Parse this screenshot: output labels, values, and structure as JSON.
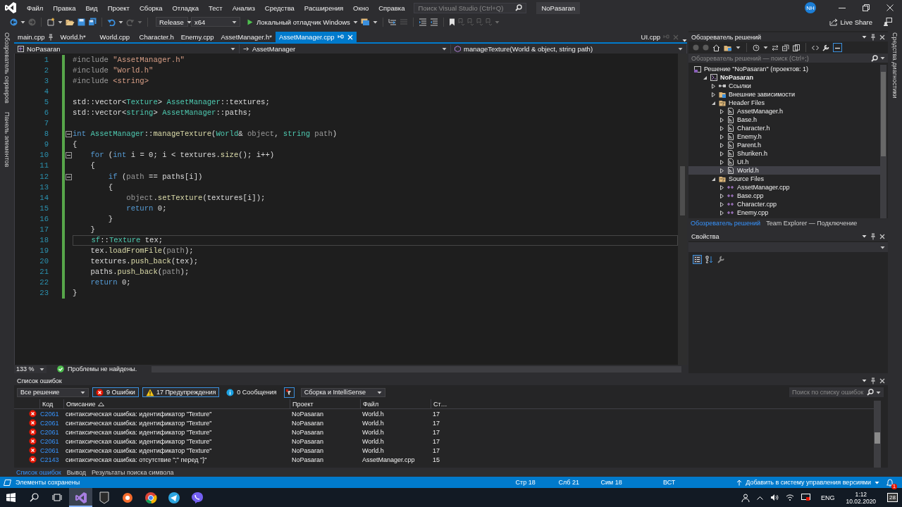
{
  "window": {
    "title": "NoPasaran",
    "account_initials": "NH"
  },
  "menu": [
    "Файл",
    "Правка",
    "Вид",
    "Проект",
    "Сборка",
    "Отладка",
    "Тест",
    "Анализ",
    "Средства",
    "Расширения",
    "Окно",
    "Справка"
  ],
  "search": {
    "placeholder": "Поиск Visual Studio (Ctrl+Q)"
  },
  "toolbar": {
    "configuration": "Release",
    "platform": "x64",
    "debugger": "Локальный отладчик Windows",
    "live_share": "Live Share"
  },
  "side_strips": {
    "left": [
      "Обозреватель серверов",
      "Панель элементов"
    ],
    "right": [
      "Средства диагностики"
    ]
  },
  "editor": {
    "tabs": [
      {
        "label": "main.cpp",
        "selected": false,
        "pinned": true
      },
      {
        "label": "World.h*",
        "selected": false,
        "pinned": false
      },
      {
        "label": "World.cpp",
        "selected": false,
        "pinned": false
      },
      {
        "label": "Character.h",
        "selected": false,
        "pinned": false
      },
      {
        "label": "Enemy.cpp",
        "selected": false,
        "pinned": false
      },
      {
        "label": "AssetManager.h*",
        "selected": false,
        "pinned": false
      },
      {
        "label": "AssetManager.cpp",
        "selected": true,
        "pinned": false
      }
    ],
    "right_tab": {
      "label": "UI.cpp"
    },
    "navigation": {
      "project": "NoPasaran",
      "class": "AssetManager",
      "member": "manageTexture(World & object, string path)"
    },
    "lines": [
      {
        "number": "1",
        "changed": true,
        "foldable": false,
        "current": false,
        "tokens": [
          {
            "kind": "preproc",
            "text": "#include "
          },
          {
            "kind": "string",
            "text": "\"AssetManager.h\""
          }
        ]
      },
      {
        "number": "2",
        "changed": true,
        "foldable": false,
        "current": false,
        "tokens": [
          {
            "kind": "preproc",
            "text": "#include "
          },
          {
            "kind": "string",
            "text": "\"World.h\""
          }
        ]
      },
      {
        "number": "3",
        "changed": true,
        "foldable": false,
        "current": false,
        "tokens": [
          {
            "kind": "preproc",
            "text": "#include "
          },
          {
            "kind": "string",
            "text": "<string>"
          }
        ]
      },
      {
        "number": "4",
        "changed": true,
        "foldable": false,
        "current": false
      },
      {
        "number": "5",
        "changed": true,
        "foldable": false,
        "current": false,
        "tokens": [
          {
            "kind": "plain",
            "text": "std::vector<"
          },
          {
            "kind": "type",
            "text": "Texture"
          },
          {
            "kind": "plain",
            "text": "> "
          },
          {
            "kind": "type",
            "text": "AssetManager"
          },
          {
            "kind": "plain",
            "text": "::textures;"
          }
        ]
      },
      {
        "number": "6",
        "changed": true,
        "foldable": false,
        "current": false,
        "tokens": [
          {
            "kind": "plain",
            "text": "std::vector<"
          },
          {
            "kind": "type",
            "text": "string"
          },
          {
            "kind": "plain",
            "text": "> "
          },
          {
            "kind": "type",
            "text": "AssetManager"
          },
          {
            "kind": "plain",
            "text": "::paths;"
          }
        ]
      },
      {
        "number": "7",
        "changed": true,
        "foldable": false,
        "current": false
      },
      {
        "number": "8",
        "changed": true,
        "foldable": true,
        "current": false,
        "tokens": [
          {
            "kind": "keyword",
            "text": "int"
          },
          {
            "kind": "type",
            "text": " AssetManager"
          },
          {
            "kind": "plain",
            "text": "::"
          },
          {
            "kind": "function",
            "text": "manageTexture"
          },
          {
            "kind": "plain",
            "text": "("
          },
          {
            "kind": "type",
            "text": "World"
          },
          {
            "kind": "plain",
            "text": "& "
          },
          {
            "kind": "param",
            "text": "object"
          },
          {
            "kind": "plain",
            "text": ", "
          },
          {
            "kind": "type",
            "text": "string"
          },
          {
            "kind": "param",
            "text": " path"
          },
          {
            "kind": "plain",
            "text": ")"
          }
        ]
      },
      {
        "number": "9",
        "changed": true,
        "foldable": false,
        "current": false,
        "tokens": [
          {
            "kind": "plain",
            "text": "{"
          }
        ]
      },
      {
        "number": "10",
        "changed": true,
        "foldable": true,
        "current": false,
        "tokens": [
          {
            "kind": "keyword",
            "text": "    for"
          },
          {
            "kind": "plain",
            "text": " ("
          },
          {
            "kind": "keyword",
            "text": "int"
          },
          {
            "kind": "plain",
            "text": " i = 0; i < textures."
          },
          {
            "kind": "function",
            "text": "size"
          },
          {
            "kind": "plain",
            "text": "(); i++)"
          }
        ]
      },
      {
        "number": "11",
        "changed": true,
        "foldable": false,
        "current": false,
        "tokens": [
          {
            "kind": "plain",
            "text": "    {"
          }
        ]
      },
      {
        "number": "12",
        "changed": true,
        "foldable": true,
        "current": false,
        "tokens": [
          {
            "kind": "keyword",
            "text": "        if"
          },
          {
            "kind": "plain",
            "text": " ("
          },
          {
            "kind": "param",
            "text": "path"
          },
          {
            "kind": "plain",
            "text": " == paths[i])"
          }
        ]
      },
      {
        "number": "13",
        "changed": true,
        "foldable": false,
        "current": false,
        "tokens": [
          {
            "kind": "plain",
            "text": "        {"
          }
        ]
      },
      {
        "number": "14",
        "changed": true,
        "foldable": false,
        "current": false,
        "tokens": [
          {
            "kind": "param",
            "text": "            object"
          },
          {
            "kind": "plain",
            "text": "."
          },
          {
            "kind": "function",
            "text": "setTexture"
          },
          {
            "kind": "plain",
            "text": "(textures[i]);"
          }
        ]
      },
      {
        "number": "15",
        "changed": true,
        "foldable": false,
        "current": false,
        "tokens": [
          {
            "kind": "keyword",
            "text": "            return"
          },
          {
            "kind": "plain",
            "text": " 0;"
          }
        ]
      },
      {
        "number": "16",
        "changed": true,
        "foldable": false,
        "current": false,
        "tokens": [
          {
            "kind": "plain",
            "text": "        }"
          }
        ]
      },
      {
        "number": "17",
        "changed": true,
        "foldable": false,
        "current": false,
        "tokens": [
          {
            "kind": "plain",
            "text": "    }"
          }
        ]
      },
      {
        "number": "18",
        "changed": true,
        "foldable": false,
        "current": true,
        "tokens": [
          {
            "kind": "type",
            "text": "    sf"
          },
          {
            "kind": "plain",
            "text": "::"
          },
          {
            "kind": "type",
            "text": "Texture"
          },
          {
            "kind": "plain",
            "text": " tex;"
          }
        ]
      },
      {
        "number": "19",
        "changed": true,
        "foldable": false,
        "current": false,
        "tokens": [
          {
            "kind": "plain",
            "text": "    tex."
          },
          {
            "kind": "function",
            "text": "loadFromFile"
          },
          {
            "kind": "plain",
            "text": "("
          },
          {
            "kind": "param",
            "text": "path"
          },
          {
            "kind": "plain",
            "text": ");"
          }
        ]
      },
      {
        "number": "20",
        "changed": true,
        "foldable": false,
        "current": false,
        "tokens": [
          {
            "kind": "plain",
            "text": "    textures."
          },
          {
            "kind": "function",
            "text": "push_back"
          },
          {
            "kind": "plain",
            "text": "(tex);"
          }
        ]
      },
      {
        "number": "21",
        "changed": true,
        "foldable": false,
        "current": false,
        "tokens": [
          {
            "kind": "plain",
            "text": "    paths."
          },
          {
            "kind": "function",
            "text": "push_back"
          },
          {
            "kind": "plain",
            "text": "("
          },
          {
            "kind": "param",
            "text": "path"
          },
          {
            "kind": "plain",
            "text": ");"
          }
        ]
      },
      {
        "number": "22",
        "changed": true,
        "foldable": false,
        "current": false,
        "tokens": [
          {
            "kind": "keyword",
            "text": "    return"
          },
          {
            "kind": "plain",
            "text": " 0;"
          }
        ]
      },
      {
        "number": "23",
        "changed": true,
        "foldable": false,
        "current": false,
        "tokens": [
          {
            "kind": "plain",
            "text": "}"
          }
        ]
      }
    ],
    "zoom": "133 %",
    "issues": "Проблемы не найдены."
  },
  "solution_explorer": {
    "title": "Обозреватель решений",
    "search_placeholder": "Обозреватель решений — поиск (Ctrl+;)",
    "tree": [
      {
        "kind": "solution",
        "label": "Решение \"NoPasaran\"  (проектов: 1)",
        "selected": false,
        "children": [
          {
            "kind": "project",
            "label": "NoPasaran",
            "selected": false,
            "expanded": true,
            "children": [
              {
                "kind": "references",
                "label": "Ссылки",
                "selected": false,
                "expanded": false
              },
              {
                "kind": "external",
                "label": "Внешние зависимости",
                "selected": false,
                "expanded": false
              },
              {
                "kind": "folder",
                "label": "Header Files",
                "selected": false,
                "expanded": true,
                "children": [
                  {
                    "kind": "header",
                    "label": "AssetManager.h",
                    "selected": false,
                    "expanded": false
                  },
                  {
                    "kind": "header",
                    "label": "Base.h",
                    "selected": false,
                    "expanded": false
                  },
                  {
                    "kind": "header",
                    "label": "Character.h",
                    "selected": false,
                    "expanded": false
                  },
                  {
                    "kind": "header",
                    "label": "Enemy.h",
                    "selected": false,
                    "expanded": false
                  },
                  {
                    "kind": "header",
                    "label": "Parent.h",
                    "selected": false,
                    "expanded": false
                  },
                  {
                    "kind": "header",
                    "label": "Shuriken.h",
                    "selected": false,
                    "expanded": false
                  },
                  {
                    "kind": "header",
                    "label": "UI.h",
                    "selected": false,
                    "expanded": false
                  },
                  {
                    "kind": "header",
                    "label": "World.h",
                    "selected": true,
                    "expanded": false
                  }
                ]
              },
              {
                "kind": "folder",
                "label": "Source Files",
                "selected": false,
                "expanded": true,
                "children": [
                  {
                    "kind": "source",
                    "label": "AssetManager.cpp",
                    "selected": false,
                    "expanded": false
                  },
                  {
                    "kind": "source",
                    "label": "Base.cpp",
                    "selected": false,
                    "expanded": false
                  },
                  {
                    "kind": "source",
                    "label": "Character.cpp",
                    "selected": false,
                    "expanded": false
                  },
                  {
                    "kind": "source",
                    "label": "Enemy.cpp",
                    "selected": false,
                    "expanded": false
                  }
                ]
              }
            ]
          }
        ]
      }
    ],
    "tabs": [
      {
        "label": "Обозреватель решений",
        "selected": true
      },
      {
        "label": "Team Explorer — Подключение",
        "selected": false
      }
    ]
  },
  "properties": {
    "title": "Свойства"
  },
  "error_list": {
    "title": "Список ошибок",
    "scope": "Все решение",
    "filters": [
      {
        "kind": "error",
        "label": "9 Ошибки",
        "selected": true
      },
      {
        "kind": "warning",
        "label": "17 Предупреждения",
        "selected": true
      },
      {
        "kind": "message",
        "label": "0 Сообщения",
        "selected": false
      }
    ],
    "source": "Сборка и IntelliSense",
    "search_placeholder": "Поиск по списку ошибок",
    "columns": [
      "Код",
      "Описание",
      "Проект",
      "Файл",
      "Ст…"
    ],
    "rows": [
      {
        "code": "C2061",
        "description": "синтаксическая ошибка: идентификатор \"Texture\"",
        "project": "NoPasaran",
        "file": "World.h",
        "line": "17"
      },
      {
        "code": "C2061",
        "description": "синтаксическая ошибка: идентификатор \"Texture\"",
        "project": "NoPasaran",
        "file": "World.h",
        "line": "17"
      },
      {
        "code": "C2061",
        "description": "синтаксическая ошибка: идентификатор \"Texture\"",
        "project": "NoPasaran",
        "file": "World.h",
        "line": "17"
      },
      {
        "code": "C2061",
        "description": "синтаксическая ошибка: идентификатор \"Texture\"",
        "project": "NoPasaran",
        "file": "World.h",
        "line": "17"
      },
      {
        "code": "C2061",
        "description": "синтаксическая ошибка: идентификатор \"Texture\"",
        "project": "NoPasaran",
        "file": "World.h",
        "line": "17"
      },
      {
        "code": "C2143",
        "description": "синтаксическая ошибка: отсутствие \";\" перед \"}\"",
        "project": "NoPasaran",
        "file": "AssetManager.cpp",
        "line": "15"
      }
    ],
    "tabs": [
      {
        "label": "Список ошибок",
        "selected": true
      },
      {
        "label": "Вывод",
        "selected": false
      },
      {
        "label": "Результаты поиска символа",
        "selected": false
      }
    ]
  },
  "status_bar": {
    "message": "Элементы сохранены",
    "line": "Стр 18",
    "column": "Слб 21",
    "char": "Сим 18",
    "mode": "ВСТ",
    "source_control": "Добавить в систему управления версиями",
    "notifications": "1"
  },
  "taskbar": {
    "apps": [
      {
        "kind": "visual-studio",
        "selected": true
      },
      {
        "kind": "epic",
        "selected": false
      },
      {
        "kind": "origin",
        "selected": false
      },
      {
        "kind": "chrome",
        "selected": false
      },
      {
        "kind": "telegram",
        "selected": false
      },
      {
        "kind": "viber",
        "selected": false
      }
    ],
    "language": "ENG",
    "time": "1:12",
    "date": "10.02.2020",
    "notifications": "28"
  }
}
